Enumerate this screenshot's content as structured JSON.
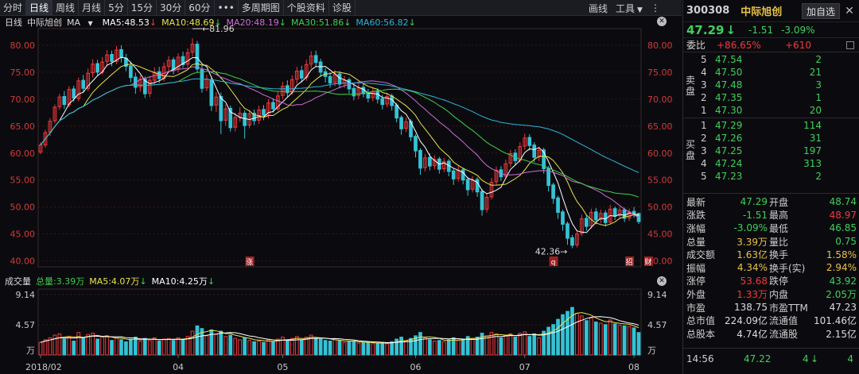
{
  "toolbar": {
    "tabs": [
      "分时",
      "日线",
      "周线",
      "月线",
      "5分",
      "15分",
      "30分",
      "60分",
      "•••",
      "多周期图",
      "个股资料",
      "诊股"
    ],
    "active_tab": "日线",
    "draw_label": "画线",
    "tools_label": "工具",
    "more_label": "⋮"
  },
  "ma_header": {
    "period": "日线",
    "stock_name": "中际旭创",
    "indicator": "MA",
    "ma5": "MA5:48.53",
    "ma10": "MA10:48.69",
    "ma20": "MA20:48.19",
    "ma30": "MA30:51.86",
    "ma60": "MA60:56.82"
  },
  "volume_header": {
    "title": "成交量",
    "total": "总量:3.39万",
    "ma5": "MA5:4.07万",
    "ma10": "MA10:4.25万"
  },
  "colors": {
    "up": "#f0393d",
    "down": "#35c3d5",
    "ma5": "#ffffff",
    "ma10": "#e8e24a",
    "ma20": "#d06bd8",
    "ma30": "#3fcf4a",
    "ma60": "#2fb3d8"
  },
  "chart_data": {
    "type": "candlestick",
    "price_ticks": [
      "80.00",
      "75.00",
      "70.00",
      "65.00",
      "60.00",
      "55.00",
      "50.00",
      "45.00",
      "40.00"
    ],
    "price_range": [
      39.5,
      82.5
    ],
    "volume_ticks": [
      "9.14",
      "4.57"
    ],
    "volume_unit": "万",
    "volume_range": [
      0,
      9.14
    ],
    "x_labels": [
      "2018/02",
      "04",
      "05",
      "06",
      "07",
      "08"
    ],
    "x_label_index": [
      0,
      29,
      51,
      79,
      102,
      125
    ],
    "annotations": {
      "high": "81.96",
      "low": "42.36",
      "markers": [
        "涨",
        "q",
        "招",
        "财"
      ],
      "marker_index": [
        44,
        108,
        124,
        128
      ]
    },
    "candles": [
      [
        60.2,
        61.5,
        62.0,
        59.8,
        1.9
      ],
      [
        61.5,
        63.8,
        64.3,
        61.0,
        2.3
      ],
      [
        63.9,
        65.9,
        66.5,
        63.2,
        2.6
      ],
      [
        66.0,
        68.5,
        69.0,
        65.5,
        3.0
      ],
      [
        68.6,
        70.4,
        71.0,
        68.0,
        3.2
      ],
      [
        70.5,
        69.0,
        71.5,
        68.2,
        2.4
      ],
      [
        69.0,
        71.8,
        72.4,
        68.5,
        2.8
      ],
      [
        71.9,
        70.2,
        72.5,
        69.5,
        2.1
      ],
      [
        70.1,
        73.4,
        74.0,
        69.6,
        3.4
      ],
      [
        73.5,
        72.0,
        74.5,
        71.2,
        2.6
      ],
      [
        72.0,
        74.8,
        75.7,
        71.5,
        3.1
      ],
      [
        74.9,
        76.5,
        77.4,
        74.0,
        3.3
      ],
      [
        76.6,
        75.0,
        77.3,
        74.3,
        2.4
      ],
      [
        75.0,
        76.9,
        77.8,
        74.6,
        2.7
      ],
      [
        77.0,
        78.2,
        79.1,
        76.2,
        2.9
      ],
      [
        78.3,
        77.0,
        79.0,
        76.1,
        2.2
      ],
      [
        77.0,
        79.1,
        79.9,
        76.5,
        2.6
      ],
      [
        79.2,
        77.7,
        80.0,
        76.8,
        2.3
      ],
      [
        77.6,
        76.1,
        78.4,
        75.2,
        2.0
      ],
      [
        76.2,
        74.0,
        77.0,
        73.1,
        2.4
      ],
      [
        74.1,
        72.2,
        74.9,
        71.0,
        2.7
      ],
      [
        72.3,
        73.7,
        74.4,
        71.4,
        2.1
      ],
      [
        73.7,
        71.0,
        74.2,
        70.2,
        2.5
      ],
      [
        71.1,
        73.5,
        74.3,
        70.4,
        2.2
      ],
      [
        73.5,
        75.0,
        75.9,
        72.6,
        2.6
      ],
      [
        75.1,
        73.8,
        76.0,
        73.0,
        2.1
      ],
      [
        73.9,
        76.0,
        76.8,
        73.3,
        2.4
      ],
      [
        76.1,
        77.2,
        78.0,
        75.1,
        2.5
      ],
      [
        77.3,
        75.5,
        77.8,
        74.6,
        2.2
      ],
      [
        75.6,
        77.8,
        78.5,
        75.0,
        2.6
      ],
      [
        77.9,
        76.4,
        78.8,
        75.8,
        2.3
      ],
      [
        76.5,
        78.6,
        79.4,
        76.0,
        2.8
      ],
      [
        78.7,
        80.2,
        81.3,
        77.9,
        3.6
      ],
      [
        80.2,
        75.6,
        80.8,
        75.0,
        4.4
      ],
      [
        75.5,
        72.0,
        76.3,
        71.2,
        4.0
      ],
      [
        72.1,
        73.7,
        74.5,
        71.5,
        2.9
      ],
      [
        73.6,
        68.8,
        74.2,
        67.8,
        3.8
      ],
      [
        68.9,
        70.4,
        71.3,
        67.6,
        3.1
      ],
      [
        70.5,
        66.0,
        71.2,
        63.5,
        3.6
      ],
      [
        66.1,
        68.2,
        69.0,
        65.1,
        2.8
      ],
      [
        68.3,
        64.7,
        68.8,
        64.0,
        3.0
      ],
      [
        64.8,
        66.6,
        67.5,
        64.0,
        2.5
      ],
      [
        66.7,
        67.4,
        68.5,
        65.8,
        2.3
      ],
      [
        67.4,
        65.1,
        67.9,
        62.7,
        2.6
      ],
      [
        65.2,
        67.3,
        68.0,
        64.6,
        2.2
      ],
      [
        67.4,
        66.0,
        68.1,
        65.2,
        2.0
      ],
      [
        66.1,
        68.0,
        68.8,
        65.4,
        2.1
      ],
      [
        68.1,
        67.0,
        68.9,
        66.1,
        1.9
      ],
      [
        67.0,
        69.3,
        70.0,
        66.4,
        2.3
      ],
      [
        69.4,
        68.2,
        70.2,
        67.5,
        2.0
      ],
      [
        68.2,
        70.6,
        71.4,
        67.8,
        2.4
      ],
      [
        70.7,
        72.4,
        73.2,
        70.0,
        2.7
      ],
      [
        72.5,
        71.2,
        73.5,
        70.4,
        2.2
      ],
      [
        71.3,
        73.6,
        74.4,
        70.8,
        2.5
      ],
      [
        73.7,
        75.2,
        76.0,
        72.9,
        2.8
      ],
      [
        75.3,
        73.9,
        76.2,
        73.1,
        2.3
      ],
      [
        74.0,
        76.4,
        77.3,
        73.4,
        2.7
      ],
      [
        76.5,
        78.0,
        78.9,
        75.7,
        3.0
      ],
      [
        78.1,
        76.8,
        79.0,
        76.0,
        2.5
      ],
      [
        76.9,
        75.0,
        77.5,
        74.1,
        2.4
      ],
      [
        75.1,
        74.2,
        75.8,
        73.1,
        2.2
      ],
      [
        74.2,
        73.0,
        75.0,
        72.1,
        2.1
      ],
      [
        73.1,
        74.6,
        75.4,
        72.4,
        2.3
      ],
      [
        74.7,
        72.8,
        75.2,
        72.0,
        2.2
      ],
      [
        72.9,
        73.5,
        74.3,
        72.1,
        1.9
      ],
      [
        73.6,
        71.9,
        74.0,
        71.0,
        2.0
      ],
      [
        72.0,
        70.6,
        72.8,
        69.8,
        2.1
      ],
      [
        70.7,
        72.1,
        72.9,
        70.0,
        1.8
      ],
      [
        72.2,
        71.0,
        73.0,
        70.3,
        1.9
      ],
      [
        71.1,
        70.2,
        71.9,
        69.4,
        1.8
      ],
      [
        70.3,
        71.4,
        72.1,
        69.6,
        1.7
      ],
      [
        71.5,
        70.0,
        72.0,
        69.2,
        1.8
      ],
      [
        70.1,
        69.0,
        70.8,
        68.1,
        1.9
      ],
      [
        69.1,
        70.5,
        71.2,
        68.5,
        1.7
      ],
      [
        70.6,
        68.8,
        71.0,
        67.9,
        2.0
      ],
      [
        68.9,
        66.5,
        69.3,
        65.7,
        2.4
      ],
      [
        66.6,
        64.5,
        67.0,
        63.4,
        2.7
      ],
      [
        64.6,
        65.8,
        66.6,
        63.9,
        2.1
      ],
      [
        65.9,
        63.0,
        66.3,
        62.2,
        2.5
      ],
      [
        63.1,
        60.4,
        63.5,
        59.2,
        2.9
      ],
      [
        60.5,
        57.2,
        60.9,
        56.0,
        3.4
      ],
      [
        57.3,
        59.1,
        59.8,
        56.6,
        2.6
      ],
      [
        59.2,
        57.6,
        60.0,
        56.8,
        2.3
      ],
      [
        57.7,
        58.8,
        59.6,
        57.0,
        2.1
      ],
      [
        58.9,
        57.0,
        59.3,
        56.2,
        2.2
      ],
      [
        57.1,
        58.4,
        59.1,
        56.5,
        2.0
      ],
      [
        58.5,
        56.6,
        58.9,
        55.7,
        2.3
      ],
      [
        56.7,
        55.2,
        57.2,
        54.1,
        2.6
      ],
      [
        55.3,
        56.8,
        57.6,
        54.7,
        2.2
      ],
      [
        56.9,
        55.0,
        57.3,
        54.2,
        2.4
      ],
      [
        55.1,
        53.2,
        55.6,
        52.1,
        2.8
      ],
      [
        53.3,
        55.0,
        55.7,
        52.7,
        2.5
      ],
      [
        55.1,
        52.8,
        55.5,
        51.9,
        2.7
      ],
      [
        52.9,
        49.5,
        53.3,
        48.4,
        3.3
      ],
      [
        49.6,
        51.8,
        52.6,
        49.0,
        2.9
      ],
      [
        51.9,
        54.6,
        55.4,
        51.4,
        3.4
      ],
      [
        54.7,
        56.8,
        57.5,
        54.1,
        3.2
      ],
      [
        56.9,
        55.6,
        57.6,
        54.8,
        2.6
      ],
      [
        55.7,
        58.0,
        58.8,
        55.2,
        2.9
      ],
      [
        58.1,
        59.9,
        60.6,
        57.4,
        3.2
      ],
      [
        60.0,
        58.6,
        60.7,
        57.8,
        2.7
      ],
      [
        58.7,
        61.2,
        62.0,
        58.2,
        3.3
      ],
      [
        61.3,
        62.8,
        63.6,
        60.6,
        3.5
      ],
      [
        62.9,
        61.4,
        63.5,
        60.5,
        2.8
      ],
      [
        61.5,
        59.2,
        62.0,
        58.3,
        3.2
      ],
      [
        59.3,
        60.5,
        61.2,
        58.5,
        2.6
      ],
      [
        60.6,
        57.1,
        61.0,
        56.2,
        3.6
      ],
      [
        57.2,
        54.0,
        57.6,
        52.9,
        4.2
      ],
      [
        54.1,
        51.6,
        54.5,
        50.6,
        4.6
      ],
      [
        51.7,
        49.0,
        52.1,
        47.8,
        5.4
      ],
      [
        49.1,
        46.8,
        49.5,
        45.6,
        6.1
      ],
      [
        46.9,
        44.2,
        47.3,
        43.0,
        6.6
      ],
      [
        44.3,
        42.9,
        44.8,
        42.36,
        7.2
      ],
      [
        43.0,
        45.0,
        45.7,
        42.5,
        6.3
      ],
      [
        45.1,
        47.8,
        48.6,
        44.6,
        5.9
      ],
      [
        47.9,
        46.4,
        48.5,
        45.6,
        5.2
      ],
      [
        46.5,
        49.0,
        49.7,
        46.0,
        5.6
      ],
      [
        49.1,
        47.6,
        49.8,
        46.8,
        5.0
      ],
      [
        47.7,
        48.8,
        49.5,
        47.0,
        4.8
      ],
      [
        48.9,
        47.1,
        49.4,
        46.4,
        4.6
      ],
      [
        47.2,
        49.6,
        50.4,
        46.8,
        5.3
      ],
      [
        49.7,
        48.3,
        50.1,
        47.6,
        4.7
      ],
      [
        48.4,
        49.4,
        50.0,
        47.8,
        4.5
      ],
      [
        49.5,
        47.9,
        49.9,
        47.2,
        4.4
      ],
      [
        48.0,
        49.1,
        49.7,
        47.4,
        4.3
      ],
      [
        49.2,
        48.8,
        50.0,
        48.0,
        4.1
      ],
      [
        48.8,
        47.29,
        48.97,
        46.85,
        3.39
      ]
    ]
  },
  "quote": {
    "code": "300308",
    "name": "中际旭创",
    "add_label": "加自选",
    "close_label": "✕",
    "price": "47.29",
    "arrow": "↓",
    "change": "-1.51",
    "change_pct": "-3.09%",
    "weibi_label": "委比",
    "weibi_pct": "+86.65%",
    "weibi_num": "+610",
    "sell_side_label": "卖盘",
    "buy_side_label": "买盘",
    "asks": [
      {
        "lv": "5",
        "price": "47.54",
        "qty": "2"
      },
      {
        "lv": "4",
        "price": "47.50",
        "qty": "21"
      },
      {
        "lv": "3",
        "price": "47.48",
        "qty": "3"
      },
      {
        "lv": "2",
        "price": "47.35",
        "qty": "1"
      },
      {
        "lv": "1",
        "price": "47.30",
        "qty": "20"
      }
    ],
    "bids": [
      {
        "lv": "1",
        "price": "47.29",
        "qty": "114"
      },
      {
        "lv": "2",
        "price": "47.26",
        "qty": "31"
      },
      {
        "lv": "3",
        "price": "47.25",
        "qty": "197"
      },
      {
        "lv": "4",
        "price": "47.24",
        "qty": "313"
      },
      {
        "lv": "5",
        "price": "47.23",
        "qty": "2"
      }
    ],
    "stats": [
      {
        "k1": "最新",
        "v1": "47.29",
        "c1": "grn",
        "k2": "开盘",
        "v2": "48.74",
        "c2": "grn"
      },
      {
        "k1": "涨跌",
        "v1": "-1.51",
        "c1": "grn",
        "k2": "最高",
        "v2": "48.97",
        "c2": "red"
      },
      {
        "k1": "涨幅",
        "v1": "-3.09%",
        "c1": "grn",
        "k2": "最低",
        "v2": "46.85",
        "c2": "grn"
      },
      {
        "k1": "总量",
        "v1": "3.39万",
        "c1": "yel",
        "k2": "量比",
        "v2": "0.75",
        "c2": "grn"
      },
      {
        "k1": "成交额",
        "v1": "1.63亿",
        "c1": "yel",
        "k2": "换手",
        "v2": "1.58%",
        "c2": "yel"
      },
      {
        "k1": "振幅",
        "v1": "4.34%",
        "c1": "yel",
        "k2": "换手(实)",
        "v2": "2.94%",
        "c2": "yel"
      },
      {
        "k1": "涨停",
        "v1": "53.68",
        "c1": "red",
        "k2": "跌停",
        "v2": "43.92",
        "c2": "grn"
      },
      {
        "k1": "外盘",
        "v1": "1.33万",
        "c1": "red",
        "k2": "内盘",
        "v2": "2.05万",
        "c2": "grn"
      },
      {
        "k1": "市盈",
        "v1": "138.75",
        "c1": "wht",
        "k2": "市盈TTM",
        "v2": "47.23",
        "c2": "wht"
      },
      {
        "k1": "总市值",
        "v1": "224.09亿",
        "c1": "wht",
        "k2": "流通值",
        "v2": "101.46亿",
        "c2": "wht"
      },
      {
        "k1": "总股本",
        "v1": "4.74亿",
        "c1": "wht",
        "k2": "流通股",
        "v2": "2.15亿",
        "c2": "wht"
      }
    ],
    "tick_time": "14:56",
    "tick_price": "47.22",
    "tick_vol": "4",
    "tick_arrow": "↓",
    "tick_vol2": "4"
  }
}
